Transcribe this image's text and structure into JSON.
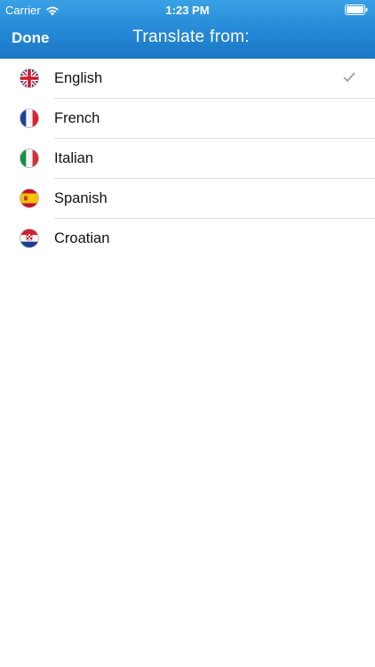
{
  "status_bar": {
    "carrier": "Carrier",
    "time": "1:23 PM",
    "wifi_icon": "wifi-icon",
    "battery_icon": "battery-icon"
  },
  "nav": {
    "done_label": "Done",
    "title": "Translate from:"
  },
  "colors": {
    "header_top": "#3aa0e6",
    "header_bottom": "#1b77c4",
    "checkmark": "#9e9e9e"
  },
  "languages": [
    {
      "label": "English",
      "flag_icon": "uk-flag-icon",
      "selected": true
    },
    {
      "label": "French",
      "flag_icon": "france-flag-icon",
      "selected": false
    },
    {
      "label": "Italian",
      "flag_icon": "italy-flag-icon",
      "selected": false
    },
    {
      "label": "Spanish",
      "flag_icon": "spain-flag-icon",
      "selected": false
    },
    {
      "label": "Croatian",
      "flag_icon": "croatia-flag-icon",
      "selected": false
    }
  ]
}
